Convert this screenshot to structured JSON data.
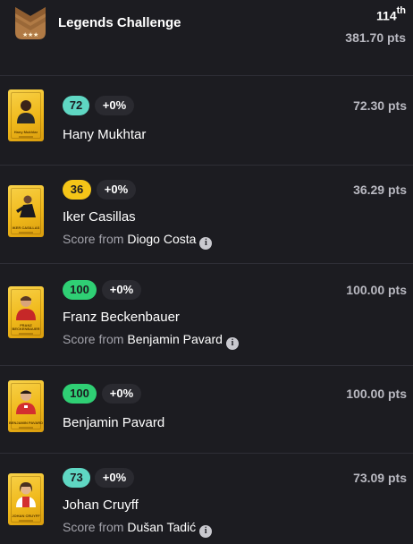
{
  "header": {
    "title": "Legends Challenge",
    "rank_number": "114",
    "rank_suffix": "th",
    "total_points": "381.70 pts",
    "trophy_icon": "chevron-stars-badge-icon"
  },
  "colors": {
    "background": "#1c1c21",
    "badge_teal": "#5fd7c3",
    "badge_yellow": "#f5c518",
    "badge_green": "#2fcf74",
    "card_gold": "#f0b91b",
    "trophy_bronze": "#b07a45"
  },
  "lineup": [
    {
      "player": "Hany Mukhtar",
      "card_name": "Hany Mukhtar",
      "score": "72",
      "score_color": "#5fd7c3",
      "delta": "+0%",
      "points": "72.30 pts",
      "score_from_label": "",
      "score_from_player": ""
    },
    {
      "player": "Iker Casillas",
      "card_name": "IKER CASILLAS",
      "score": "36",
      "score_color": "#f5c518",
      "delta": "+0%",
      "points": "36.29 pts",
      "score_from_label": "Score from",
      "score_from_player": "Diogo Costa"
    },
    {
      "player": "Franz Beckenbauer",
      "card_name": "FRANZ BECKENBAUER",
      "score": "100",
      "score_color": "#2fcf74",
      "delta": "+0%",
      "points": "100.00 pts",
      "score_from_label": "Score from",
      "score_from_player": "Benjamin Pavard"
    },
    {
      "player": "Benjamin Pavard",
      "card_name": "BENJAMIN PAVARD",
      "score": "100",
      "score_color": "#2fcf74",
      "delta": "+0%",
      "points": "100.00 pts",
      "score_from_label": "",
      "score_from_player": ""
    },
    {
      "player": "Johan Cruyff",
      "card_name": "JOHAN CRUYFF",
      "score": "73",
      "score_color": "#5fd7c3",
      "delta": "+0%",
      "points": "73.09 pts",
      "score_from_label": "Score from",
      "score_from_player": "Dušan Tadić"
    }
  ]
}
